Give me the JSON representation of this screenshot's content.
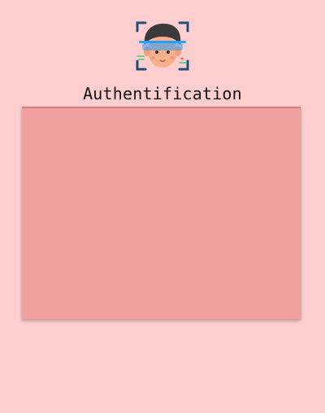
{
  "header": {
    "logo_icon": "face-recognition-icon",
    "title": "Authentification"
  },
  "colors": {
    "background": "#ffcfcf",
    "panel": "#f19f9f",
    "scan_line": "#2b9df4",
    "bracket": "#1f4f7a"
  }
}
